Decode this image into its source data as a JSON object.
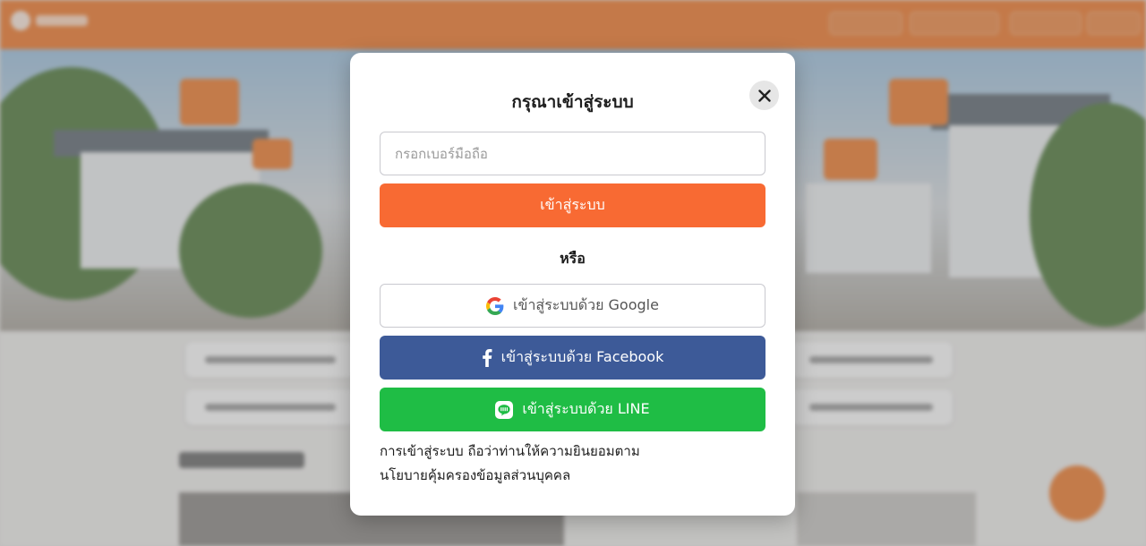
{
  "modal": {
    "title": "กรุณาเข้าสู่ระบบ",
    "close_icon": "close-icon",
    "phone_placeholder": "กรอกเบอร์มือถือ",
    "login_label": "เข้าสู่ระบบ",
    "or_label": "หรือ",
    "google_label": "เข้าสู่ระบบด้วย Google",
    "facebook_label": "เข้าสู่ระบบด้วย Facebook",
    "line_label": "เข้าสู่ระบบด้วย LINE",
    "consent_line1": "การเข้าสู่ระบบ ถือว่าท่านให้ความยินยอมตาม",
    "consent_line2": "นโยบายคุ้มครองข้อมูลส่วนบุคคล"
  },
  "colors": {
    "brand_orange": "#f86a33",
    "facebook_blue": "#3d5a98",
    "line_green": "#1fbd45",
    "header_orange": "#f27a2c"
  },
  "icons": [
    "google-icon",
    "facebook-icon",
    "line-icon",
    "close-icon"
  ]
}
